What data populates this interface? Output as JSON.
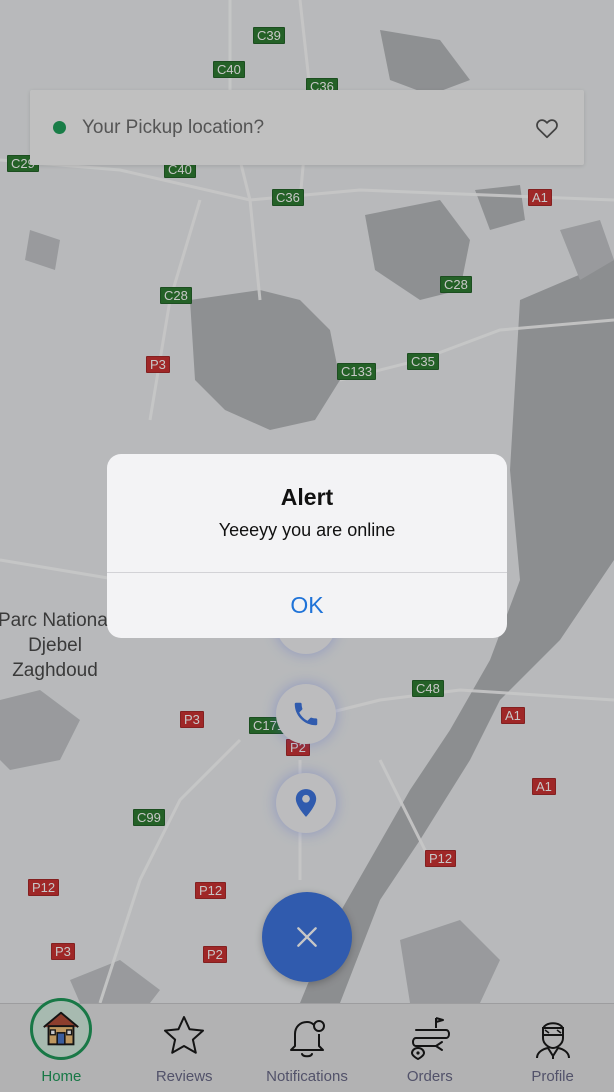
{
  "search": {
    "placeholder": "Your Pickup location?"
  },
  "map": {
    "road_labels": [
      {
        "id": "c39",
        "text": "C39",
        "color": "green"
      },
      {
        "id": "c40a",
        "text": "C40",
        "color": "green"
      },
      {
        "id": "c36a",
        "text": "C36",
        "color": "green"
      },
      {
        "id": "c29",
        "text": "C29",
        "color": "green"
      },
      {
        "id": "c40b",
        "text": "C40",
        "color": "green"
      },
      {
        "id": "c36b",
        "text": "C36",
        "color": "green"
      },
      {
        "id": "a1a",
        "text": "A1",
        "color": "red"
      },
      {
        "id": "c28a",
        "text": "C28",
        "color": "green"
      },
      {
        "id": "c28b",
        "text": "C28",
        "color": "green"
      },
      {
        "id": "p3a",
        "text": "P3",
        "color": "red"
      },
      {
        "id": "c133",
        "text": "C133",
        "color": "green"
      },
      {
        "id": "c35",
        "text": "C35",
        "color": "green"
      },
      {
        "id": "c48",
        "text": "C48",
        "color": "green"
      },
      {
        "id": "p3b",
        "text": "P3",
        "color": "red"
      },
      {
        "id": "c171",
        "text": "C171",
        "color": "green"
      },
      {
        "id": "a1b",
        "text": "A1",
        "color": "red"
      },
      {
        "id": "p2a",
        "text": "P2",
        "color": "red"
      },
      {
        "id": "a1c",
        "text": "A1",
        "color": "red"
      },
      {
        "id": "c99",
        "text": "C99",
        "color": "green"
      },
      {
        "id": "p12a",
        "text": "P12",
        "color": "red"
      },
      {
        "id": "p12b",
        "text": "P12",
        "color": "red"
      },
      {
        "id": "p12c",
        "text": "P12",
        "color": "red"
      },
      {
        "id": "p3c",
        "text": "P3",
        "color": "red"
      },
      {
        "id": "p2b",
        "text": "P2",
        "color": "red"
      }
    ],
    "place_label": "Parc National\nDjebel\nZaghdoud"
  },
  "alert": {
    "title": "Alert",
    "message": "Yeeeyy you are online",
    "ok_label": "OK"
  },
  "tabs": [
    {
      "label": "Home",
      "icon": "house-icon",
      "active": true
    },
    {
      "label": "Reviews",
      "icon": "star-icon",
      "active": false
    },
    {
      "label": "Notifications",
      "icon": "bell-icon",
      "active": false
    },
    {
      "label": "Orders",
      "icon": "route-icon",
      "active": false
    },
    {
      "label": "Profile",
      "icon": "driver-icon",
      "active": false
    }
  ],
  "colors": {
    "accent_green": "#1f9a5a",
    "fab_blue": "#3e75df",
    "link_blue": "#1f73d8"
  }
}
